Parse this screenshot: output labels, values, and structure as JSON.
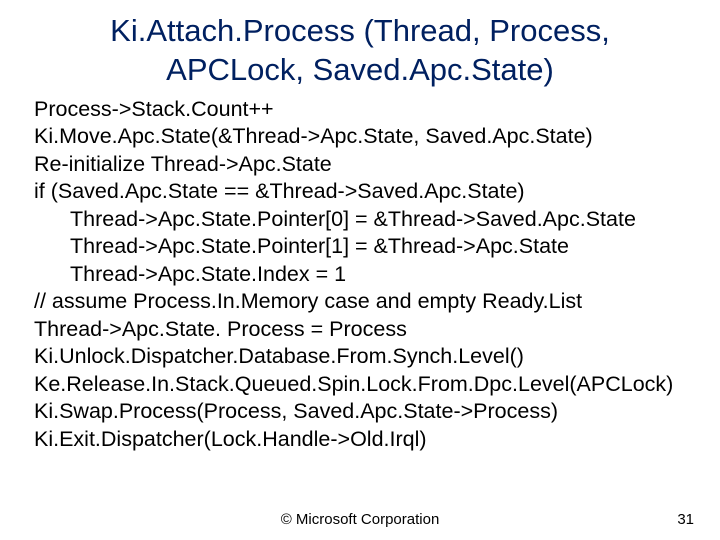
{
  "title": {
    "line1": "Ki.Attach.Process (Thread, Process,",
    "line2": "APCLock, Saved.Apc.State)"
  },
  "code": {
    "l1": "Process->Stack.Count++",
    "l2": "Ki.Move.Apc.State(&Thread->Apc.State, Saved.Apc.State)",
    "l3": "Re-initialize Thread->Apc.State",
    "l4": "if (Saved.Apc.State == &Thread->Saved.Apc.State)",
    "l5": "Thread->Apc.State.Pointer[0] = &Thread->Saved.Apc.State",
    "l6": "Thread->Apc.State.Pointer[1] = &Thread->Apc.State",
    "l7": "Thread->Apc.State.Index = 1",
    "l8": "// assume Process.In.Memory case and empty Ready.List",
    "l9": "Thread->Apc.State. Process = Process",
    "l10": "Ki.Unlock.Dispatcher.Database.From.Synch.Level()",
    "l11": "Ke.Release.In.Stack.Queued.Spin.Lock.From.Dpc.Level(APCLock)",
    "l12": "Ki.Swap.Process(Process, Saved.Apc.State->Process)",
    "l13": "Ki.Exit.Dispatcher(Lock.Handle->Old.Irql)"
  },
  "footer": {
    "copyright": "© Microsoft Corporation",
    "page": "31"
  }
}
